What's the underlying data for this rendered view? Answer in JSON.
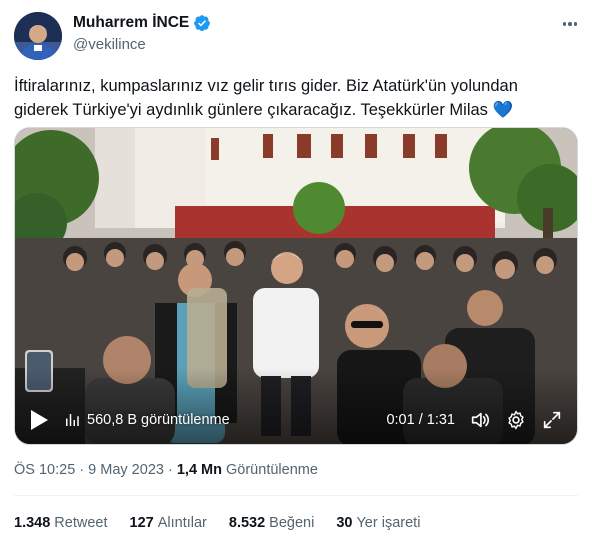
{
  "author": {
    "display_name": "Muharrem İNCE",
    "handle": "@vekilince",
    "verified_color": "#1d9bf0"
  },
  "tweet": {
    "text": "İftiralarınız, kumpaslarınız vız gelir tırıs gider. Biz Atatürk'ün yolundan giderek Türkiye'yi aydınlık günlere çıkaracağız. Teşekkürler Milas 💙"
  },
  "video": {
    "views_overlay": "560,8 B görüntülenme",
    "time": "0:01 / 1:31",
    "controls_icons": [
      "play-icon",
      "volume-icon",
      "settings-gear-icon",
      "fullscreen-icon"
    ]
  },
  "meta": {
    "time": "ÖS 10:25",
    "sep1": "·",
    "date": "9 May 2023",
    "sep2": "·",
    "views_count": "1,4 Mn",
    "views_label": "Görüntülenme"
  },
  "stats": {
    "retweets": {
      "count": "1.348",
      "label": "Retweet"
    },
    "quotes": {
      "count": "127",
      "label": "Alıntılar"
    },
    "likes": {
      "count": "8.532",
      "label": "Beğeni"
    },
    "bookmarks": {
      "count": "30",
      "label": "Yer işareti"
    }
  },
  "colors": {
    "text_primary": "#0f1419",
    "text_secondary": "#536471",
    "accent": "#1d9bf0"
  }
}
